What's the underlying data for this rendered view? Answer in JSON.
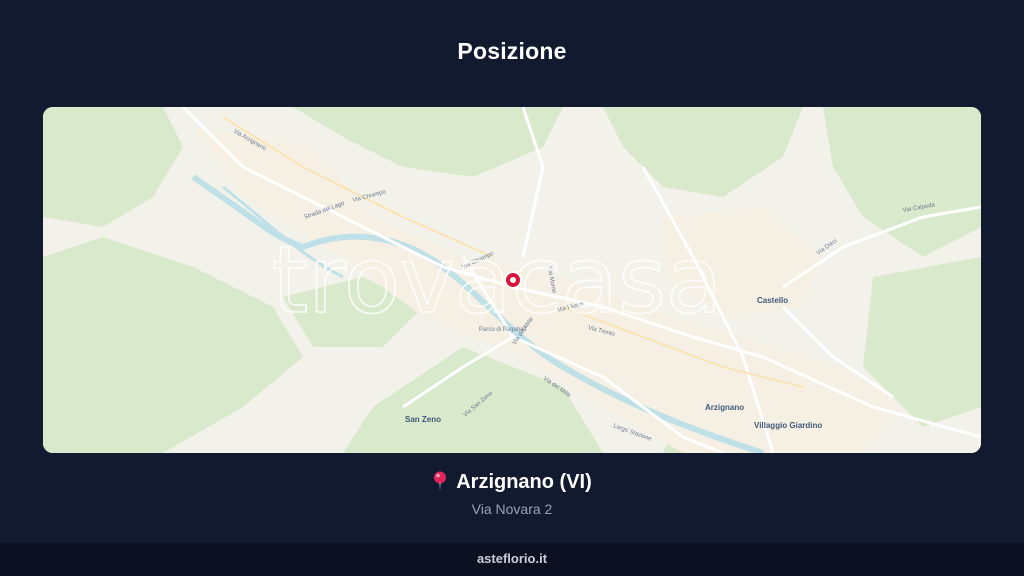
{
  "page": {
    "title": "Posizione"
  },
  "map": {
    "watermark": "trovacasa",
    "places": [
      "Castello",
      "Arzignano",
      "Villaggio Giardino",
      "San Zeno"
    ],
    "streets": [
      "Via Arzignano",
      "Via Chiampo",
      "Strada del Lago",
      "Via Fiume",
      "Via Trento",
      "Via dei Mille",
      "Largo Stazione",
      "Via Calpeda",
      "Via Dieci",
      "Via Monte",
      "Via San Zeno",
      "Parco di Pagabali"
    ]
  },
  "location": {
    "city": "Arzignano (VI)",
    "address": "Via Novara 2"
  },
  "footer": {
    "site": "asteflorio.it"
  },
  "colors": {
    "background": "#111a2e",
    "pin": "#d9143a",
    "water": "#bfe0e6",
    "green": "#d7e8c8"
  }
}
